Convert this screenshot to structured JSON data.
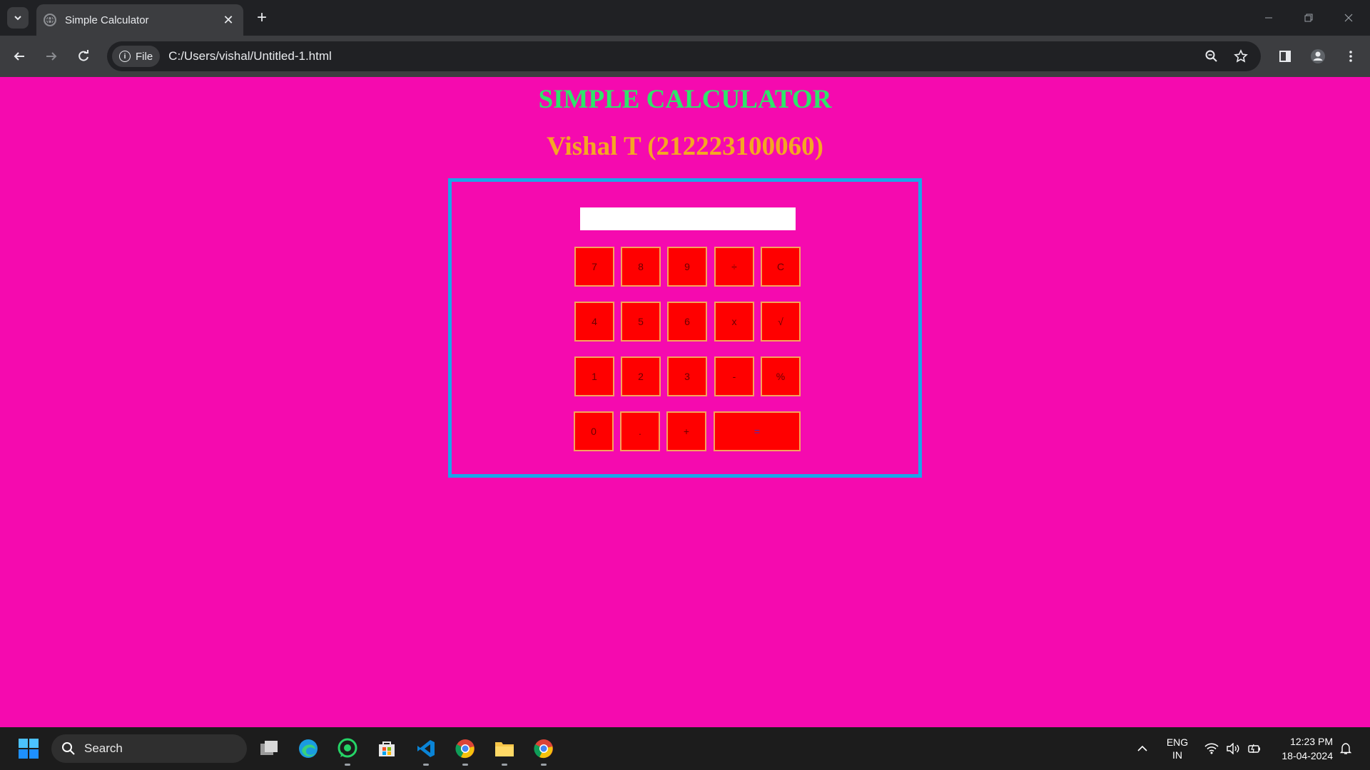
{
  "browser": {
    "tab_title": "Simple Calculator",
    "tab_close": "✕",
    "new_tab": "+",
    "chip_label": "File",
    "url": "C:/Users/vishal/Untitled-1.html"
  },
  "page": {
    "heading": "SIMPLE CALCULATOR",
    "subheading": "Vishal T (212223100060)",
    "display_value": "",
    "keys": {
      "k7": "7",
      "k8": "8",
      "k9": "9",
      "div": "÷",
      "clear": "C",
      "k4": "4",
      "k5": "5",
      "k6": "6",
      "mul": "x",
      "sqrt": "√",
      "k1": "1",
      "k2": "2",
      "k3": "3",
      "sub": "-",
      "pct": "%",
      "k0": "0",
      "dot": ".",
      "add": "+",
      "eq": "="
    }
  },
  "taskbar": {
    "search_placeholder": "Search",
    "lang_line1": "ENG",
    "lang_line2": "IN",
    "time": "12:23 PM",
    "date": "18-04-2024"
  },
  "colors": {
    "page_background": "#f50aaf",
    "heading": "#2ee56a",
    "subheading": "#f5a623",
    "calculator_border": "#1aa6e8",
    "key_fill": "#ff0000",
    "key_border": "#f5a35c"
  },
  "icons": [
    "tab-search-icon",
    "globe-icon",
    "close-icon",
    "plus-icon",
    "minimize-icon",
    "restore-icon",
    "window-close-icon",
    "back-arrow-icon",
    "forward-arrow-icon",
    "reload-icon",
    "info-icon",
    "zoom-icon",
    "star-icon",
    "side-panel-icon",
    "profile-icon",
    "more-menu-icon",
    "windows-start-icon",
    "search-icon",
    "task-view-icon",
    "edge-icon",
    "whatsapp-icon",
    "store-icon",
    "vscode-icon",
    "chrome-icon",
    "file-explorer-icon",
    "chevron-up-icon",
    "wifi-icon",
    "volume-icon",
    "battery-icon",
    "notification-icon"
  ]
}
